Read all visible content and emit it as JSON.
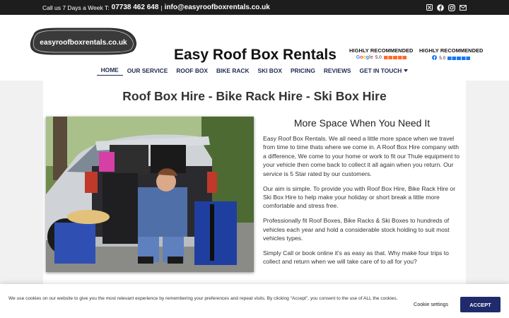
{
  "topbar": {
    "call_label": "Call us 7 Days a Week T:",
    "phone": "07738 462 648",
    "separator": "|",
    "email": "info@easyroofboxrentals.co.uk",
    "social_icons": [
      "x-icon",
      "facebook-icon",
      "instagram-icon",
      "email-icon"
    ]
  },
  "header": {
    "logo_text": "easyroofboxrentals.co.uk",
    "brand": "Easy Roof Box Rentals",
    "badges": [
      {
        "title": "HIGHLY RECOMMENDED",
        "source": "Google",
        "rating": "5.0"
      },
      {
        "title": "HIGHLY RECOMMENDED",
        "source": "Facebook",
        "rating": "5.0"
      }
    ]
  },
  "nav": {
    "items": [
      "HOME",
      "OUR SERVICE",
      "ROOF BOX",
      "BIKE RACK",
      "SKI BOX",
      "PRICING",
      "REVIEWS",
      "GET IN TOUCH"
    ],
    "active": "HOME"
  },
  "main": {
    "heading": "Roof Box Hire - Bike Rack Hire - Ski Box Hire",
    "subheading": "More Space When You Need It",
    "paragraphs": [
      "Easy Roof Box Rentals.  We all need a little more space when we travel from time to time thats where we come in.  A Roof Box Hire company with a difference, We come to your home or work to fit our Thule equipment to your vehicle then come back to collect it all again when you return.  Our service is 5 Star rated by our customers.",
      "Our aim is simple. To provide you with Roof Box Hire, Bike Rack Hire or Ski Box Hire to help make your holiday or short break a little more comfortable and stress free.",
      "Professionally fit Roof Boxes, Bike Racks & Ski Boxes to hundreds of vehicles each year and hold a considerable stock holding to suit most vehicles types.",
      "Simply Call or book online it's as easy as that. Why make four trips to collect and return when we will take care of to all for you?"
    ]
  },
  "cookie": {
    "text": "We use cookies on our website to give you the most relevant experience by remembering your preferences and repeat visits. By clicking “Accept”, you consent to the use of ALL the cookies.",
    "settings_label": "Cookie settings",
    "accept_label": "ACCEPT"
  },
  "colors": {
    "topbar_bg": "#1d1d1d",
    "nav_text": "#1f2a55",
    "accept_bg": "#1f2b6b",
    "google_stars": "#ff6a2b",
    "facebook_stars": "#1877f2"
  }
}
